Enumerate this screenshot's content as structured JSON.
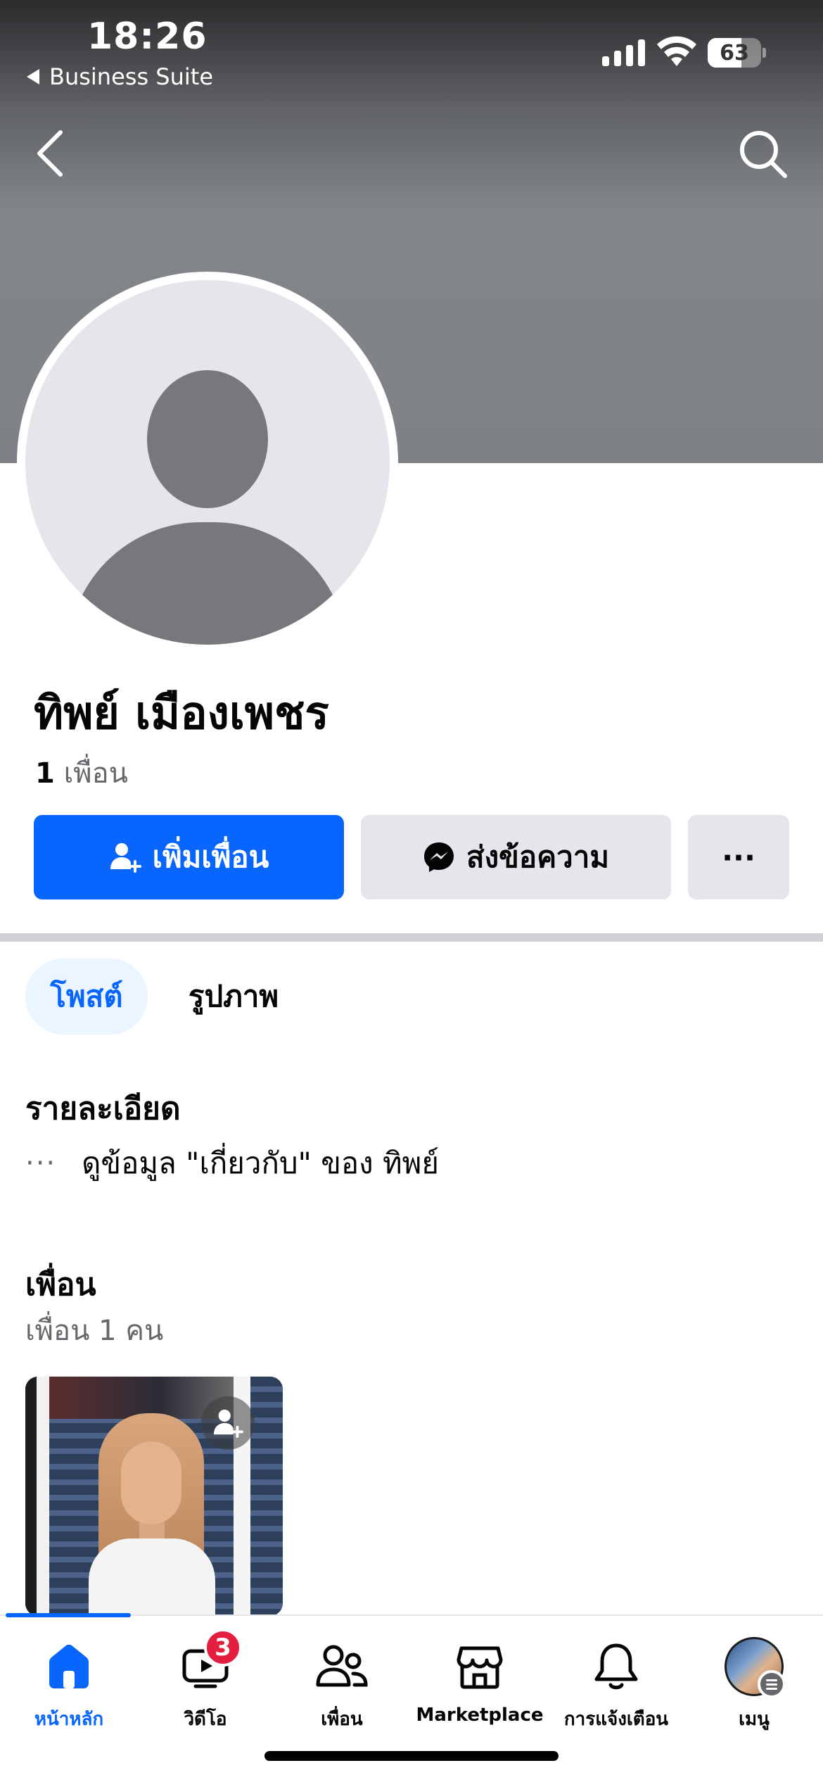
{
  "status_bar": {
    "time": "18:26",
    "back_app": "Business Suite",
    "battery": "63"
  },
  "profile": {
    "name": "ทิพย์ เมืองเพชร",
    "friend_count_number": "1",
    "friend_count_label": "เพื่อน"
  },
  "actions": {
    "add_friend": "เพิ่มเพื่อน",
    "message": "ส่งข้อความ",
    "more": "···"
  },
  "tabs": {
    "posts": "โพสต์",
    "photos": "รูปภาพ"
  },
  "details": {
    "title": "รายละเอียด",
    "dots": "···",
    "about_link": "ดูข้อมูล \"เกี่ยวกับ\" ของ ทิพย์"
  },
  "friends": {
    "title": "เพื่อน",
    "subtitle": "เพื่อน 1 คน"
  },
  "bottom_nav": {
    "home": "หน้าหลัก",
    "video": "วิดีโอ",
    "video_badge": "3",
    "friends": "เพื่อน",
    "marketplace": "Marketplace",
    "notifications": "การแจ้งเตือน",
    "menu": "เมนู"
  },
  "colors": {
    "accent": "#0866ff",
    "badge": "#e41e3f",
    "secondary_button": "#e4e6eb"
  }
}
